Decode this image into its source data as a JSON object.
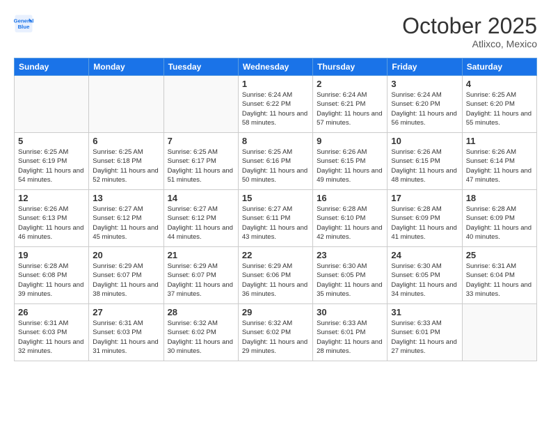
{
  "logo": {
    "line1": "General",
    "line2": "Blue"
  },
  "title": "October 2025",
  "subtitle": "Atlixco, Mexico",
  "days_header": [
    "Sunday",
    "Monday",
    "Tuesday",
    "Wednesday",
    "Thursday",
    "Friday",
    "Saturday"
  ],
  "weeks": [
    [
      {
        "day": "",
        "info": ""
      },
      {
        "day": "",
        "info": ""
      },
      {
        "day": "",
        "info": ""
      },
      {
        "day": "1",
        "info": "Sunrise: 6:24 AM\nSunset: 6:22 PM\nDaylight: 11 hours\nand 58 minutes."
      },
      {
        "day": "2",
        "info": "Sunrise: 6:24 AM\nSunset: 6:21 PM\nDaylight: 11 hours\nand 57 minutes."
      },
      {
        "day": "3",
        "info": "Sunrise: 6:24 AM\nSunset: 6:20 PM\nDaylight: 11 hours\nand 56 minutes."
      },
      {
        "day": "4",
        "info": "Sunrise: 6:25 AM\nSunset: 6:20 PM\nDaylight: 11 hours\nand 55 minutes."
      }
    ],
    [
      {
        "day": "5",
        "info": "Sunrise: 6:25 AM\nSunset: 6:19 PM\nDaylight: 11 hours\nand 54 minutes."
      },
      {
        "day": "6",
        "info": "Sunrise: 6:25 AM\nSunset: 6:18 PM\nDaylight: 11 hours\nand 52 minutes."
      },
      {
        "day": "7",
        "info": "Sunrise: 6:25 AM\nSunset: 6:17 PM\nDaylight: 11 hours\nand 51 minutes."
      },
      {
        "day": "8",
        "info": "Sunrise: 6:25 AM\nSunset: 6:16 PM\nDaylight: 11 hours\nand 50 minutes."
      },
      {
        "day": "9",
        "info": "Sunrise: 6:26 AM\nSunset: 6:15 PM\nDaylight: 11 hours\nand 49 minutes."
      },
      {
        "day": "10",
        "info": "Sunrise: 6:26 AM\nSunset: 6:15 PM\nDaylight: 11 hours\nand 48 minutes."
      },
      {
        "day": "11",
        "info": "Sunrise: 6:26 AM\nSunset: 6:14 PM\nDaylight: 11 hours\nand 47 minutes."
      }
    ],
    [
      {
        "day": "12",
        "info": "Sunrise: 6:26 AM\nSunset: 6:13 PM\nDaylight: 11 hours\nand 46 minutes."
      },
      {
        "day": "13",
        "info": "Sunrise: 6:27 AM\nSunset: 6:12 PM\nDaylight: 11 hours\nand 45 minutes."
      },
      {
        "day": "14",
        "info": "Sunrise: 6:27 AM\nSunset: 6:12 PM\nDaylight: 11 hours\nand 44 minutes."
      },
      {
        "day": "15",
        "info": "Sunrise: 6:27 AM\nSunset: 6:11 PM\nDaylight: 11 hours\nand 43 minutes."
      },
      {
        "day": "16",
        "info": "Sunrise: 6:28 AM\nSunset: 6:10 PM\nDaylight: 11 hours\nand 42 minutes."
      },
      {
        "day": "17",
        "info": "Sunrise: 6:28 AM\nSunset: 6:09 PM\nDaylight: 11 hours\nand 41 minutes."
      },
      {
        "day": "18",
        "info": "Sunrise: 6:28 AM\nSunset: 6:09 PM\nDaylight: 11 hours\nand 40 minutes."
      }
    ],
    [
      {
        "day": "19",
        "info": "Sunrise: 6:28 AM\nSunset: 6:08 PM\nDaylight: 11 hours\nand 39 minutes."
      },
      {
        "day": "20",
        "info": "Sunrise: 6:29 AM\nSunset: 6:07 PM\nDaylight: 11 hours\nand 38 minutes."
      },
      {
        "day": "21",
        "info": "Sunrise: 6:29 AM\nSunset: 6:07 PM\nDaylight: 11 hours\nand 37 minutes."
      },
      {
        "day": "22",
        "info": "Sunrise: 6:29 AM\nSunset: 6:06 PM\nDaylight: 11 hours\nand 36 minutes."
      },
      {
        "day": "23",
        "info": "Sunrise: 6:30 AM\nSunset: 6:05 PM\nDaylight: 11 hours\nand 35 minutes."
      },
      {
        "day": "24",
        "info": "Sunrise: 6:30 AM\nSunset: 6:05 PM\nDaylight: 11 hours\nand 34 minutes."
      },
      {
        "day": "25",
        "info": "Sunrise: 6:31 AM\nSunset: 6:04 PM\nDaylight: 11 hours\nand 33 minutes."
      }
    ],
    [
      {
        "day": "26",
        "info": "Sunrise: 6:31 AM\nSunset: 6:03 PM\nDaylight: 11 hours\nand 32 minutes."
      },
      {
        "day": "27",
        "info": "Sunrise: 6:31 AM\nSunset: 6:03 PM\nDaylight: 11 hours\nand 31 minutes."
      },
      {
        "day": "28",
        "info": "Sunrise: 6:32 AM\nSunset: 6:02 PM\nDaylight: 11 hours\nand 30 minutes."
      },
      {
        "day": "29",
        "info": "Sunrise: 6:32 AM\nSunset: 6:02 PM\nDaylight: 11 hours\nand 29 minutes."
      },
      {
        "day": "30",
        "info": "Sunrise: 6:33 AM\nSunset: 6:01 PM\nDaylight: 11 hours\nand 28 minutes."
      },
      {
        "day": "31",
        "info": "Sunrise: 6:33 AM\nSunset: 6:01 PM\nDaylight: 11 hours\nand 27 minutes."
      },
      {
        "day": "",
        "info": ""
      }
    ]
  ]
}
